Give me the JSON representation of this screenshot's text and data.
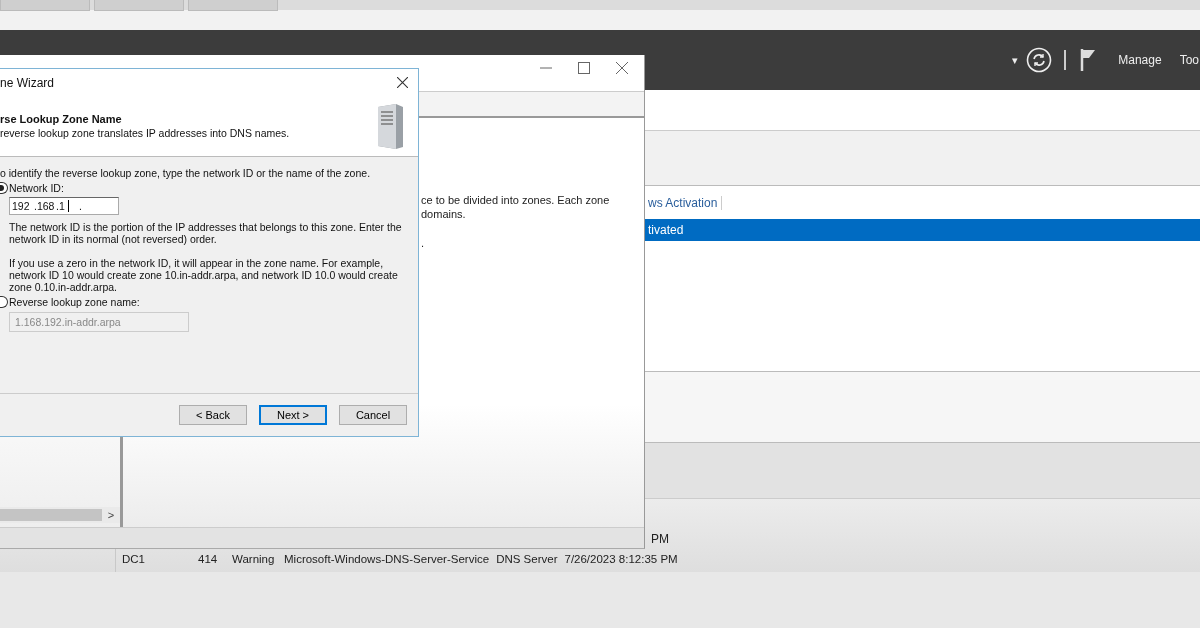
{
  "header": {
    "dropdown_glyph": "▾",
    "menu_items": [
      "Manage",
      "Too"
    ]
  },
  "scroll_arrow": ">",
  "dashboard": {
    "tab_label": "ws Activation",
    "selected_row": {
      "label": "tivated",
      "selected": true
    }
  },
  "mmc_window": {
    "description_lines": [
      "ce to be divided into zones. Each zone",
      "domains.",
      "."
    ]
  },
  "event_log": {
    "partial_time": "PM",
    "rows": [
      {
        "server": "DC1",
        "id": "414",
        "severity": "Warning",
        "source": "Microsoft-Windows-DNS-Server-Service",
        "log": "DNS Server",
        "date": "7/26/2023 8:12:35 PM"
      }
    ]
  },
  "wizard": {
    "title": "ne Wizard",
    "heading": "rse Lookup Zone Name",
    "subheading": "reverse lookup zone translates IP addresses into DNS names.",
    "instruction": "o identify the reverse lookup zone, type the network ID or the name of the zone.",
    "options": [
      {
        "label": "Network ID:",
        "selected": true
      },
      {
        "label": "Reverse lookup zone name:",
        "selected": false
      }
    ],
    "network_id": [
      "192",
      ".168",
      ".1",
      "."
    ],
    "network_id_help": "The network ID is the portion of the IP addresses that belongs to this zone. Enter the network ID in its normal (not reversed) order.",
    "zero_help": "If you use a zero in the network ID, it will appear in the zone name. For example, network ID 10 would create zone 10.in-addr.arpa, and network ID 10.0 would create zone 0.10.in-addr.arpa.",
    "zone_name": {
      "value": "1.168.192.in-addr.arpa",
      "disabled": true
    },
    "buttons": [
      {
        "label": "< Back",
        "default": false
      },
      {
        "label": "Next >",
        "default": true
      },
      {
        "label": "Cancel",
        "default": false
      }
    ]
  }
}
